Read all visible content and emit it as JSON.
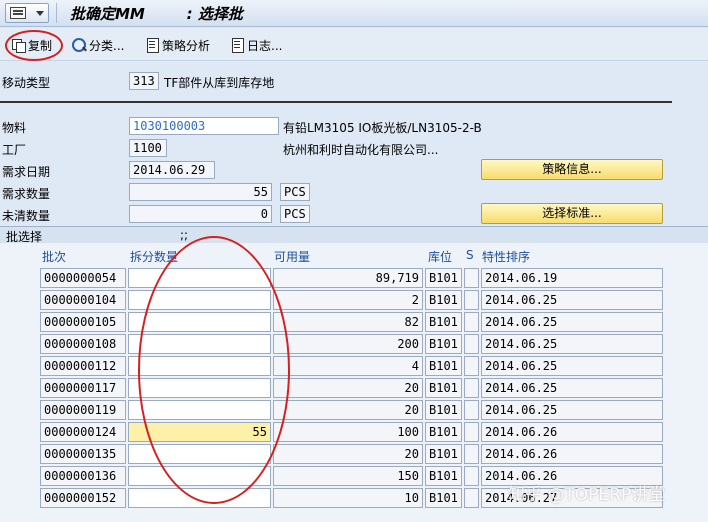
{
  "titlebar": {
    "title": "批确定MM        : 选择批"
  },
  "toolbar": {
    "copy_label": "复制",
    "classify_label": "分类...",
    "strategy_label": "策略分析",
    "log_label": "日志..."
  },
  "header": {
    "movement_type_label": "移动类型",
    "movement_type_value": "313",
    "movement_type_text": "TF部件从库到库存地"
  },
  "form": {
    "material_label": "物料",
    "material_value": "1030100003",
    "material_text": "有铅LM3105 IO板光板/LN3105-2-B",
    "plant_label": "工厂",
    "plant_value": "1100",
    "plant_text": "杭州和利时自动化有限公司...",
    "req_date_label": "需求日期",
    "req_date_value": "2014.06.29",
    "req_qty_label": "需求数量",
    "req_qty_value": "55",
    "req_qty_unit": "PCS",
    "open_qty_label": "未清数量",
    "open_qty_value": "0",
    "open_qty_unit": "PCS",
    "strategy_info_button": "策略信息...",
    "select_criteria_button": "选择标准..."
  },
  "section": {
    "title": "批选择",
    "marker": ";;"
  },
  "table": {
    "headers": {
      "batch": "批次",
      "split_qty": "拆分数量",
      "available": "可用量",
      "storage": "库位",
      "s": "S",
      "sort": "特性排序"
    },
    "rows": [
      {
        "batch": "0000000054",
        "split": "",
        "available": "89,719",
        "storage": "B101",
        "s": "",
        "sort": "2014.06.19"
      },
      {
        "batch": "0000000104",
        "split": "",
        "available": "2",
        "storage": "B101",
        "s": "",
        "sort": "2014.06.25"
      },
      {
        "batch": "0000000105",
        "split": "",
        "available": "82",
        "storage": "B101",
        "s": "",
        "sort": "2014.06.25"
      },
      {
        "batch": "0000000108",
        "split": "",
        "available": "200",
        "storage": "B101",
        "s": "",
        "sort": "2014.06.25"
      },
      {
        "batch": "0000000112",
        "split": "",
        "available": "4",
        "storage": "B101",
        "s": "",
        "sort": "2014.06.25"
      },
      {
        "batch": "0000000117",
        "split": "",
        "available": "20",
        "storage": "B101",
        "s": "",
        "sort": "2014.06.25"
      },
      {
        "batch": "0000000119",
        "split": "",
        "available": "20",
        "storage": "B101",
        "s": "",
        "sort": "2014.06.25"
      },
      {
        "batch": "0000000124",
        "split": "55",
        "available": "100",
        "storage": "B101",
        "s": "",
        "sort": "2014.06.26"
      },
      {
        "batch": "0000000135",
        "split": "",
        "available": "20",
        "storage": "B101",
        "s": "",
        "sort": "2014.06.26"
      },
      {
        "batch": "0000000136",
        "split": "",
        "available": "150",
        "storage": "B101",
        "s": "",
        "sort": "2014.06.26"
      },
      {
        "batch": "0000000152",
        "split": "",
        "available": "10",
        "storage": "B101",
        "s": "",
        "sort": "2014.06.27"
      }
    ]
  },
  "watermark": "知乎 @TOPERP讲堂",
  "colors": {
    "accent_red": "#d42020",
    "button_yellow": "#f6dd6e",
    "link_blue": "#2c6ec4"
  }
}
